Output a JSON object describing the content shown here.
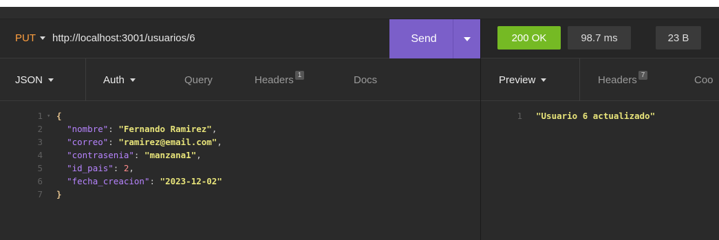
{
  "request": {
    "method": "PUT",
    "url": "http://localhost:3001/usuarios/6",
    "send_label": "Send"
  },
  "request_tabs": [
    {
      "label": "JSON",
      "active": true
    },
    {
      "label": "Auth"
    },
    {
      "label": "Query"
    },
    {
      "label": "Headers",
      "badge": "1"
    },
    {
      "label": "Docs"
    }
  ],
  "body_lines": [
    {
      "n": "1",
      "tokens": [
        [
          "brace",
          "{"
        ]
      ]
    },
    {
      "n": "2",
      "tokens": [
        [
          "key",
          "\"nombre\""
        ],
        [
          "punc",
          ": "
        ],
        [
          "str",
          "\"Fernando Ramirez\""
        ],
        [
          "punc",
          ","
        ]
      ]
    },
    {
      "n": "3",
      "tokens": [
        [
          "key",
          "\"correo\""
        ],
        [
          "punc",
          ": "
        ],
        [
          "str",
          "\"ramirez@email.com\""
        ],
        [
          "punc",
          ","
        ]
      ]
    },
    {
      "n": "4",
      "tokens": [
        [
          "key",
          "\"contrasenia\""
        ],
        [
          "punc",
          ": "
        ],
        [
          "str",
          "\"manzana1\""
        ],
        [
          "punc",
          ","
        ]
      ]
    },
    {
      "n": "5",
      "tokens": [
        [
          "key",
          "\"id_pais\""
        ],
        [
          "punc",
          ": "
        ],
        [
          "num",
          "2"
        ],
        [
          "punc",
          ","
        ]
      ]
    },
    {
      "n": "6",
      "tokens": [
        [
          "key",
          "\"fecha_creacion\""
        ],
        [
          "punc",
          ": "
        ],
        [
          "str",
          "\"2023-12-02\""
        ]
      ]
    },
    {
      "n": "7",
      "tokens": [
        [
          "brace",
          "}"
        ]
      ]
    }
  ],
  "response": {
    "status": "200 OK",
    "time": "98.7 ms",
    "size": "23 B",
    "status_color": "#75ba24"
  },
  "response_tabs": [
    {
      "label": "Preview",
      "active": true
    },
    {
      "label": "Headers",
      "badge": "7"
    },
    {
      "label": "Coo"
    }
  ],
  "preview_lines": [
    {
      "n": "1",
      "text": "\"Usuario 6 actualizado\""
    }
  ],
  "colors": {
    "accent": "#7b5fc9",
    "method": "#ff9f3f"
  }
}
